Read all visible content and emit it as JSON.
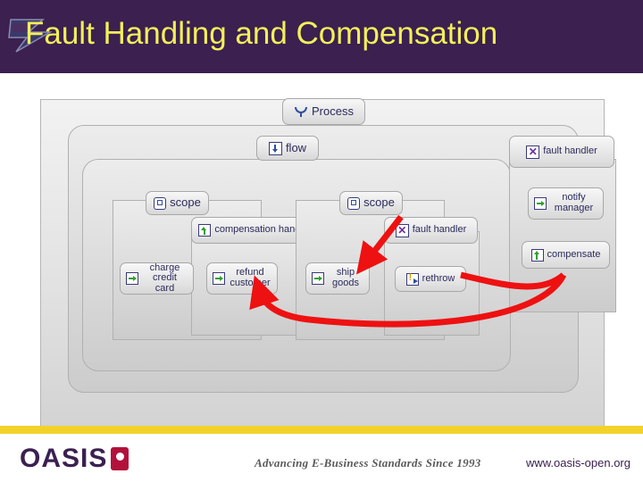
{
  "header": {
    "title": "Fault Handling and Compensation",
    "logo_icon": "oasis-swoosh-logo",
    "bg_color": "#3b2050",
    "title_color": "#f2ef5a"
  },
  "diagram": {
    "type": "bpel-process-diagram",
    "accent_arrow_color": "#ee1111",
    "nodes": [
      {
        "id": "process",
        "label": "Process",
        "icon": "process-icon"
      },
      {
        "id": "flow",
        "label": "flow",
        "icon": "flow-icon"
      },
      {
        "id": "scope-left",
        "label": "scope",
        "icon": "scope-icon"
      },
      {
        "id": "scope-right",
        "label": "scope",
        "icon": "scope-icon"
      },
      {
        "id": "compensation-handler",
        "label": "compensation handler",
        "icon": "compensation-handler-icon"
      },
      {
        "id": "fault-handler-scope",
        "label": "fault handler",
        "icon": "fault-handler-icon"
      },
      {
        "id": "fault-handler-process",
        "label": "fault handler",
        "icon": "fault-handler-icon"
      },
      {
        "id": "charge-credit-card",
        "label": "charge credit card",
        "icon": "invoke-icon"
      },
      {
        "id": "refund-customer",
        "label": "refund customer",
        "icon": "invoke-icon"
      },
      {
        "id": "ship-goods",
        "label": "ship goods",
        "icon": "invoke-icon"
      },
      {
        "id": "rethrow",
        "label": "rethrow",
        "icon": "rethrow-icon"
      },
      {
        "id": "notify-manager",
        "label": "notify manager",
        "icon": "invoke-icon"
      },
      {
        "id": "compensate",
        "label": "compensate",
        "icon": "compensate-icon"
      }
    ]
  },
  "footer": {
    "brand": "OASIS",
    "brand_mark_icon": "oasis-logo-mark",
    "tagline": "Advancing E-Business Standards Since 1993",
    "url": "www.oasis-open.org",
    "bar_color": "#f2d22a"
  }
}
